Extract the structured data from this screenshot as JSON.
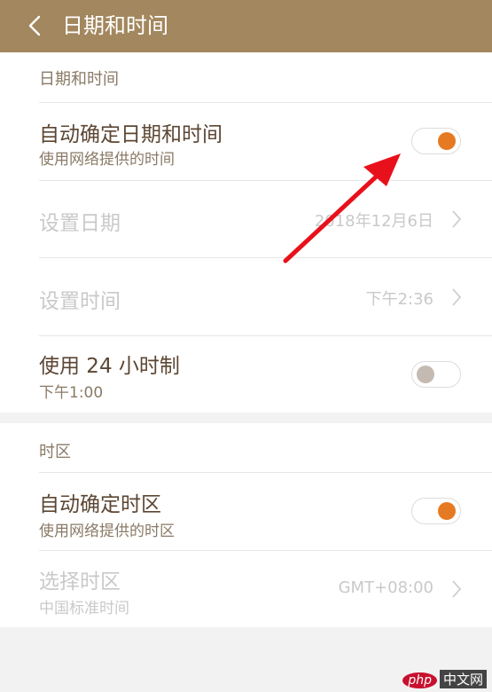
{
  "header": {
    "title": "日期和时间",
    "background_color": "#a3875e"
  },
  "section_datetime": {
    "header": "日期和时间",
    "auto_datetime": {
      "title": "自动确定日期和时间",
      "subtitle": "使用网络提供的时间",
      "toggle_on": true
    },
    "set_date": {
      "title": "设置日期",
      "value": "2018年12月6日",
      "disabled": true
    },
    "set_time": {
      "title": "设置时间",
      "value": "下午2:36",
      "disabled": true
    },
    "use_24h": {
      "title": "使用 24 小时制",
      "subtitle": "下午1:00",
      "toggle_on": false
    }
  },
  "section_timezone": {
    "header": "时区",
    "auto_timezone": {
      "title": "自动确定时区",
      "subtitle": "使用网络提供的时区",
      "toggle_on": true
    },
    "select_timezone": {
      "title": "选择时区",
      "subtitle": "中国标准时间",
      "value": "GMT+08:00",
      "disabled": true
    }
  },
  "colors": {
    "accent": "#e57a22",
    "annotation_arrow": "#e8111b"
  },
  "watermark": {
    "badge": "php",
    "text": "中文网"
  }
}
